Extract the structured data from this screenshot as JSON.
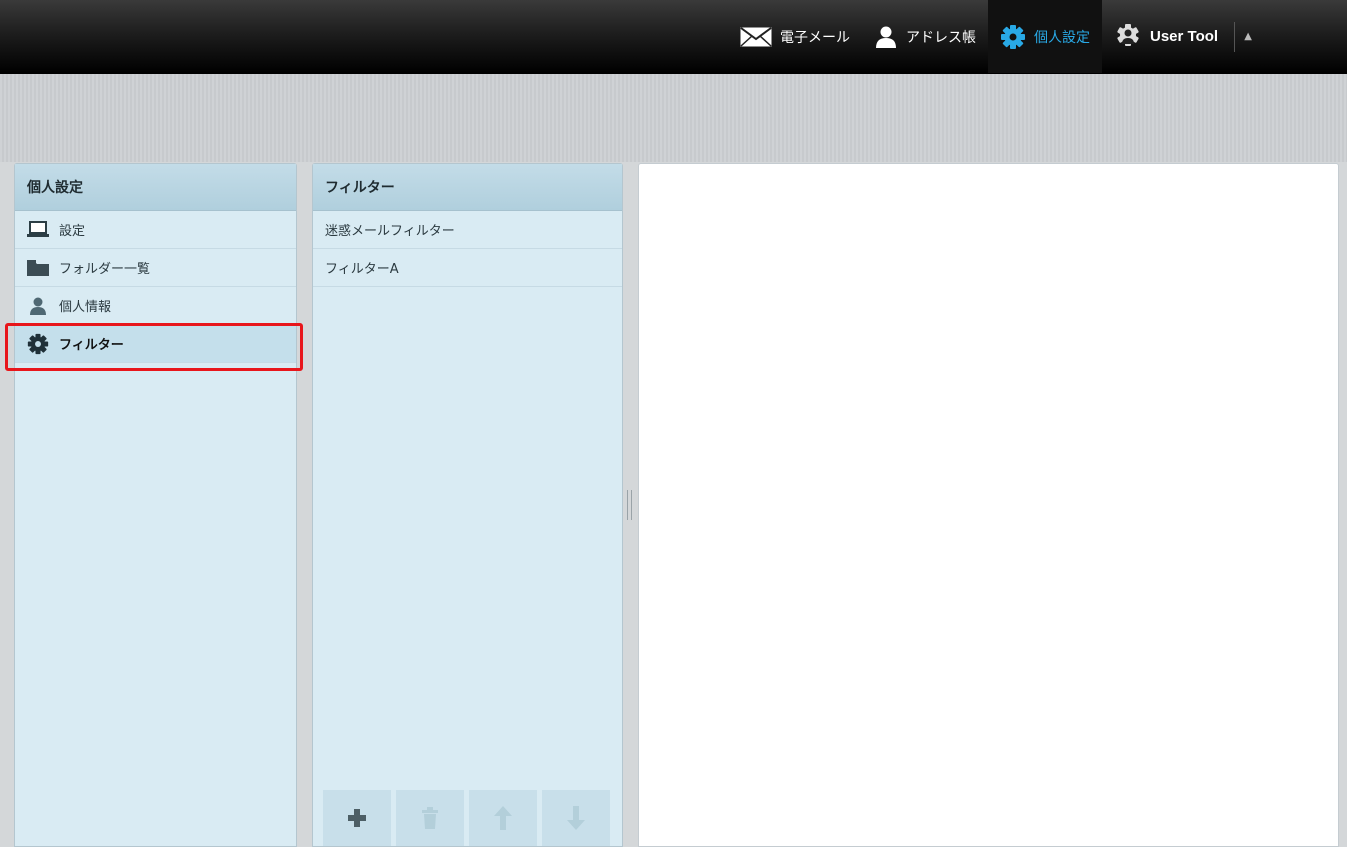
{
  "topnav": {
    "items": [
      {
        "label": "電子メール",
        "icon": "mail-icon"
      },
      {
        "label": "アドレス帳",
        "icon": "person-icon"
      },
      {
        "label": "個人設定",
        "icon": "gear-icon",
        "active": true
      },
      {
        "label": "User Tool",
        "icon": "user-tool-icon"
      }
    ],
    "accent_color": "#29a9e6"
  },
  "settings_panel": {
    "title": "個人設定",
    "items": [
      {
        "label": "設定",
        "icon": "laptop-icon"
      },
      {
        "label": "フォルダー一覧",
        "icon": "folder-icon"
      },
      {
        "label": "個人情報",
        "icon": "person-icon"
      },
      {
        "label": "フィルター",
        "icon": "gear-icon",
        "selected": true
      }
    ]
  },
  "filter_panel": {
    "title": "フィルター",
    "items": [
      {
        "label": "迷惑メールフィルター"
      },
      {
        "label": "フィルターA"
      }
    ],
    "toolbar": [
      "add-icon",
      "trash-icon",
      "arrow-up-icon",
      "arrow-down-icon"
    ]
  },
  "highlight_color": "#e8161b"
}
